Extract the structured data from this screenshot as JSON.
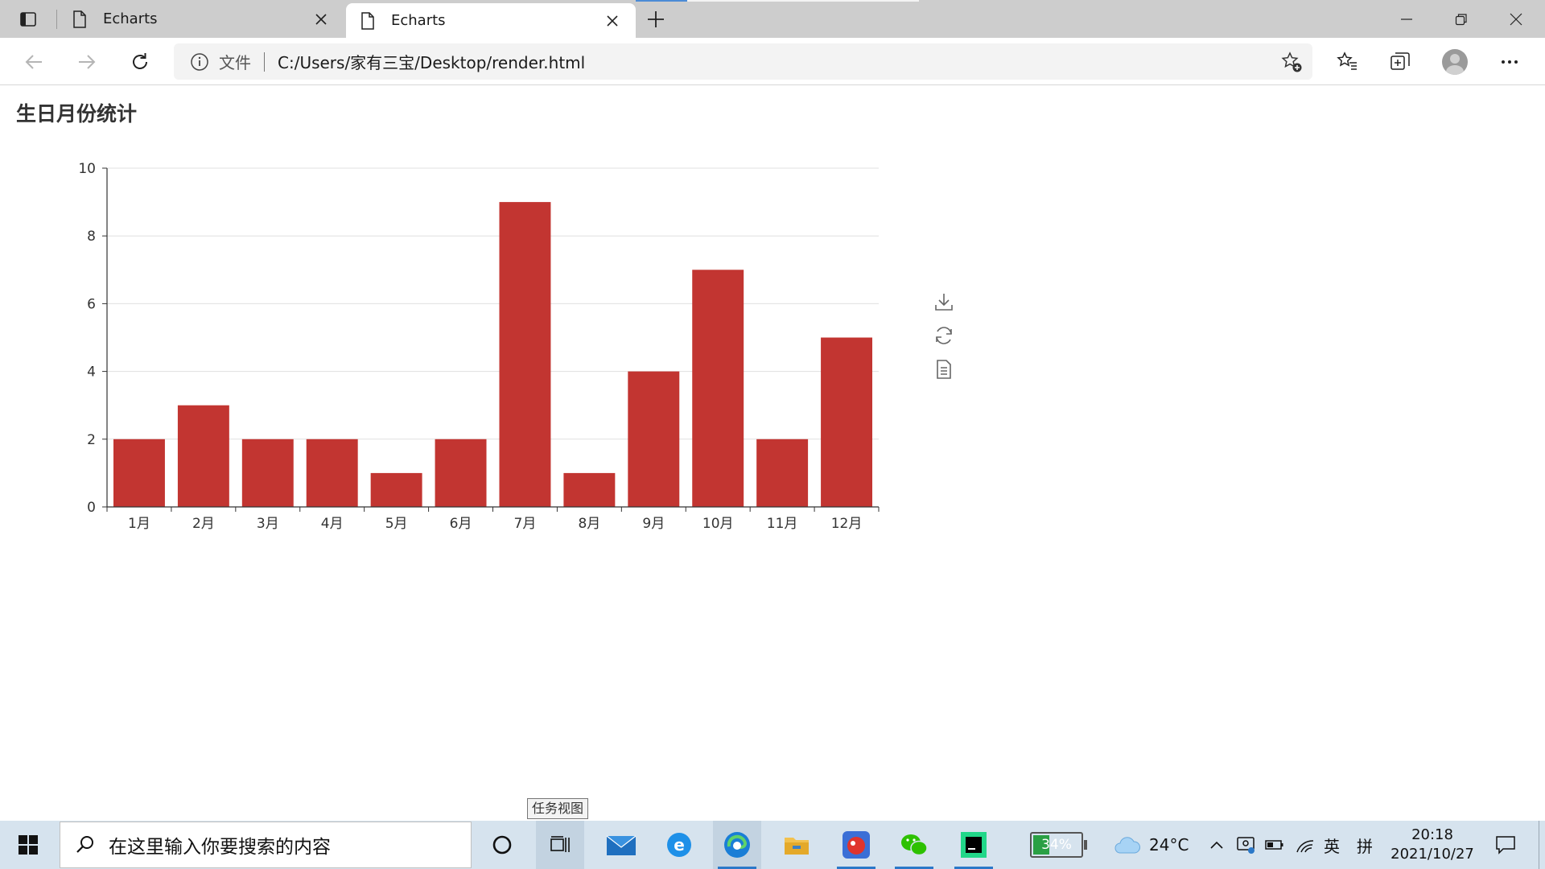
{
  "browser": {
    "tabs": [
      {
        "title": "Echarts",
        "active": false
      },
      {
        "title": "Echarts",
        "active": true
      }
    ],
    "address": {
      "scheme_label": "文件",
      "url": "C:/Users/家有三宝/Desktop/render.html"
    }
  },
  "page": {
    "title": "生日月份统计"
  },
  "chart_data": {
    "type": "bar",
    "title": "生日月份统计",
    "categories": [
      "1月",
      "2月",
      "3月",
      "4月",
      "5月",
      "6月",
      "7月",
      "8月",
      "9月",
      "10月",
      "11月",
      "12月"
    ],
    "series": [
      {
        "values": [
          2,
          3,
          2,
          2,
          1,
          2,
          9,
          1,
          4,
          7,
          2,
          5
        ],
        "color": "#c23531"
      }
    ],
    "ylim": [
      0,
      10
    ],
    "yticks": [
      0,
      2,
      4,
      6,
      8,
      10
    ],
    "grid": true,
    "toolbox": [
      "download-icon",
      "refresh-icon",
      "data-view-icon"
    ]
  },
  "tooltip": {
    "text": "任务视图"
  },
  "taskbar": {
    "search_placeholder": "在这里输入你要搜索的内容",
    "battery_percent": "34%",
    "battery_level": 0.34,
    "weather": "24°C",
    "ime_lang": "英",
    "ime_mode": "拼",
    "time": "20:18",
    "date": "2021/10/27"
  }
}
